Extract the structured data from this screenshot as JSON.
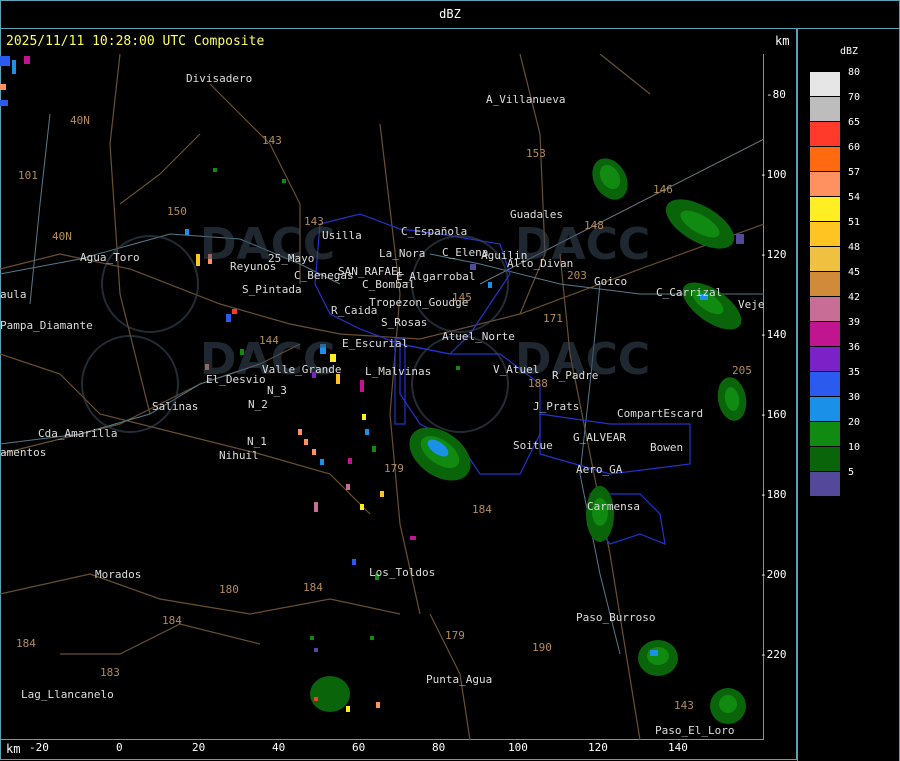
{
  "window_title": "dBZ",
  "header": {
    "timestamp": "2025/11/11 10:28:00 UTC Composite",
    "unit_top": "km",
    "unit_bottom": "km"
  },
  "legend": {
    "title": "dBZ",
    "items": [
      {
        "label": "80",
        "color": "#e6e6e6"
      },
      {
        "label": "70",
        "color": "#bdbdbd"
      },
      {
        "label": "65",
        "color": "#ff3a2a"
      },
      {
        "label": "60",
        "color": "#ff6a10"
      },
      {
        "label": "57",
        "color": "#ff9060"
      },
      {
        "label": "54",
        "color": "#ffee22"
      },
      {
        "label": "51",
        "color": "#ffc422"
      },
      {
        "label": "48",
        "color": "#f0c040"
      },
      {
        "label": "45",
        "color": "#d08a3a"
      },
      {
        "label": "42",
        "color": "#c86e96"
      },
      {
        "label": "39",
        "color": "#c01490"
      },
      {
        "label": "36",
        "color": "#7a22c8"
      },
      {
        "label": "35",
        "color": "#2a5aee"
      },
      {
        "label": "30",
        "color": "#1a90e8"
      },
      {
        "label": "20",
        "color": "#108a10"
      },
      {
        "label": "10",
        "color": "#0a640a"
      },
      {
        "label": "5",
        "color": "#54489a"
      }
    ]
  },
  "y_axis": {
    "ticks": [
      "-80",
      "-100",
      "-120",
      "-140",
      "-160",
      "-180",
      "-200",
      "-220"
    ]
  },
  "x_axis": {
    "ticks": [
      "-20",
      "0",
      "20",
      "40",
      "60",
      "80",
      "100",
      "120",
      "140"
    ]
  },
  "watermark_text": "DACC",
  "places": [
    {
      "name": "Divisadero",
      "kind": "place"
    },
    {
      "name": "A_Villanueva",
      "kind": "place"
    },
    {
      "name": "Guadales",
      "kind": "place"
    },
    {
      "name": "Goico",
      "kind": "place"
    },
    {
      "name": "Agua_Toro",
      "kind": "place"
    },
    {
      "name": "Reyunos",
      "kind": "place"
    },
    {
      "name": "25_Mayo",
      "kind": "place"
    },
    {
      "name": "C_Benegas",
      "kind": "place"
    },
    {
      "name": "SAN_RAFAEL",
      "kind": "place"
    },
    {
      "name": "S_Pintada",
      "kind": "place"
    },
    {
      "name": "C_Bombal",
      "kind": "place"
    },
    {
      "name": "R_Caida",
      "kind": "place"
    },
    {
      "name": "S_Rosas",
      "kind": "place"
    },
    {
      "name": "Usilla",
      "kind": "place"
    },
    {
      "name": "La_Nora",
      "kind": "place"
    },
    {
      "name": "C_Española",
      "kind": "place"
    },
    {
      "name": "C_Elena",
      "kind": "place"
    },
    {
      "name": "Aguilin",
      "kind": "place"
    },
    {
      "name": "Alto_Divan",
      "kind": "place"
    },
    {
      "name": "E_Algarrobal",
      "kind": "place"
    },
    {
      "name": "Tropezon_Goudge",
      "kind": "place"
    },
    {
      "name": "Atuel_Norte",
      "kind": "place"
    },
    {
      "name": "E_Escurial",
      "kind": "place"
    },
    {
      "name": "El_Desvio",
      "kind": "place"
    },
    {
      "name": "Valle_Grande",
      "kind": "place"
    },
    {
      "name": "L_Malvinas",
      "kind": "place"
    },
    {
      "name": "V_Atuel",
      "kind": "place"
    },
    {
      "name": "R_Padre",
      "kind": "place"
    },
    {
      "name": "J_Prats",
      "kind": "place"
    },
    {
      "name": "CompartEscard",
      "kind": "place"
    },
    {
      "name": "G_ALVEAR",
      "kind": "place"
    },
    {
      "name": "Bowen",
      "kind": "place"
    },
    {
      "name": "Soitue",
      "kind": "place"
    },
    {
      "name": "Aero_GA",
      "kind": "place"
    },
    {
      "name": "Carmensa",
      "kind": "place"
    },
    {
      "name": "Salinas",
      "kind": "place"
    },
    {
      "name": "Nihuil",
      "kind": "place"
    },
    {
      "name": "N_2",
      "kind": "place"
    },
    {
      "name": "N_3",
      "kind": "place"
    },
    {
      "name": "N_1",
      "kind": "place"
    },
    {
      "name": "Cda_Amarilla",
      "kind": "place"
    },
    {
      "name": "amentos",
      "kind": "place"
    },
    {
      "name": "Morados",
      "kind": "place"
    },
    {
      "name": "Los_Toldos",
      "kind": "place"
    },
    {
      "name": "Paso_Burroso",
      "kind": "place"
    },
    {
      "name": "Punta_Agua",
      "kind": "place"
    },
    {
      "name": "Lag_Llancanelo",
      "kind": "place"
    },
    {
      "name": "Paso_El_Loro",
      "kind": "place"
    },
    {
      "name": "Pampa_Diamante",
      "kind": "place"
    },
    {
      "name": "aula",
      "kind": "place"
    },
    {
      "name": "C_Carrizal",
      "kind": "place"
    },
    {
      "name": "Veje",
      "kind": "place"
    }
  ],
  "routes": [
    "40N",
    "101",
    "143",
    "153",
    "150",
    "40N",
    "146",
    "148",
    "203",
    "171",
    "143",
    "145",
    "144",
    "188",
    "179",
    "184",
    "180",
    "184",
    "184",
    "179",
    "190",
    "183",
    "143",
    "205",
    "184"
  ]
}
